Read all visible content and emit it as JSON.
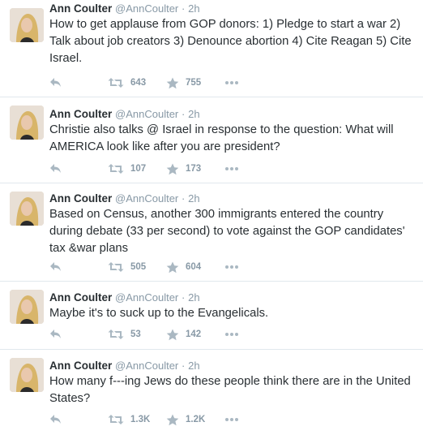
{
  "colors": {
    "text": "#292f33",
    "muted": "#8899a6",
    "divider": "#e1e8ed",
    "icon": "#aab8c2"
  },
  "tweets": [
    {
      "name": "Ann Coulter",
      "handle": "@AnnCoulter",
      "separator": "·",
      "time": "2h",
      "text": "How to get applause from GOP donors: 1) Pledge to start a war 2) Talk about job creators 3) Denounce abortion 4) Cite Reagan 5) Cite Israel.",
      "retweets": "643",
      "favorites": "755"
    },
    {
      "name": "Ann Coulter",
      "handle": "@AnnCoulter",
      "separator": "·",
      "time": "2h",
      "text": "Christie also talks @ Israel in response to the question:  What will AMERICA look like after you are president?",
      "retweets": "107",
      "favorites": "173"
    },
    {
      "name": "Ann Coulter",
      "handle": "@AnnCoulter",
      "separator": "·",
      "time": "2h",
      "text": "Based on Census, another 300 immigrants entered the country during debate (33 per second) to vote against the GOP candidates' tax &war plans",
      "retweets": "505",
      "favorites": "604"
    },
    {
      "name": "Ann Coulter",
      "handle": "@AnnCoulter",
      "separator": "·",
      "time": "2h",
      "text": "Maybe it's to suck up to the Evangelicals.",
      "retweets": "53",
      "favorites": "142"
    },
    {
      "name": "Ann Coulter",
      "handle": "@AnnCoulter",
      "separator": "·",
      "time": "2h",
      "text": "How many f---ing Jews do these people think there are in the United States?",
      "retweets": "1.3K",
      "favorites": "1.2K"
    }
  ]
}
